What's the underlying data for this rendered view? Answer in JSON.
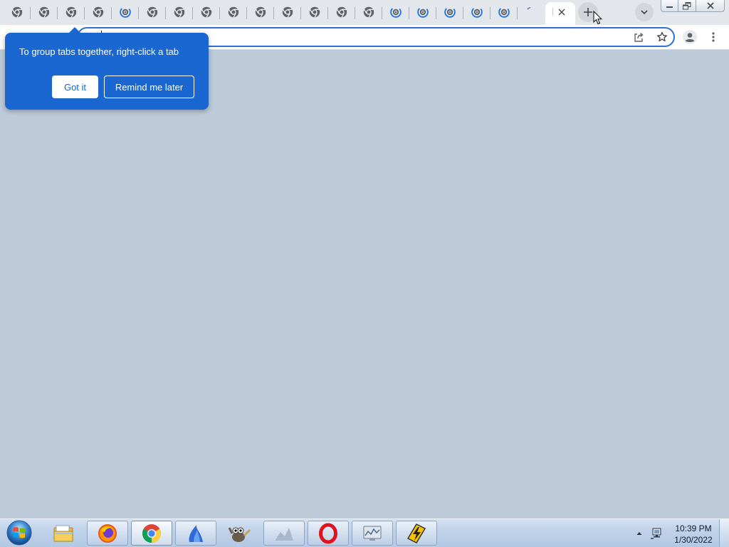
{
  "browser": {
    "tabs": [
      {
        "favicon": "chrome-icon"
      },
      {
        "favicon": "chrome-icon"
      },
      {
        "favicon": "chrome-icon"
      },
      {
        "favicon": "chrome-icon"
      },
      {
        "favicon": "loading-chrome-icon"
      },
      {
        "favicon": "chrome-icon"
      },
      {
        "favicon": "chrome-icon"
      },
      {
        "favicon": "chrome-icon"
      },
      {
        "favicon": "chrome-icon"
      },
      {
        "favicon": "chrome-icon"
      },
      {
        "favicon": "chrome-icon"
      },
      {
        "favicon": "chrome-icon"
      },
      {
        "favicon": "chrome-icon"
      },
      {
        "favicon": "chrome-icon"
      },
      {
        "favicon": "loading-chrome-icon"
      },
      {
        "favicon": "loading-chrome-icon"
      },
      {
        "favicon": "loading-chrome-icon"
      },
      {
        "favicon": "loading-chrome-icon"
      },
      {
        "favicon": "loading-chrome-icon"
      },
      {
        "favicon": "loading-spinner-icon"
      }
    ],
    "active_tab": {
      "favicon": "blank-favicon-icon"
    },
    "icons": {
      "close_tab": "close-icon",
      "new_tab": "plus-icon",
      "tab_search": "chevron-down-icon",
      "minimize": "minimize-icon",
      "restore": "restore-icon",
      "close_window": "window-close-icon",
      "share": "share-icon",
      "bookmark": "star-icon",
      "profile": "profile-avatar-icon",
      "menu": "more-vert-icon",
      "pointer": "mouse-cursor-icon"
    },
    "omnibox": {
      "value": ""
    }
  },
  "feature_promo": {
    "message": "To group tabs together, right-click a tab",
    "primary_button": "Got it",
    "secondary_button": "Remind me later"
  },
  "taskbar": {
    "start_icon": "windows-start-orb-icon",
    "apps": [
      {
        "icon": "file-explorer-icon",
        "running": false,
        "active": false
      },
      {
        "icon": "firefox-icon",
        "running": true,
        "active": false
      },
      {
        "icon": "chrome-icon",
        "running": true,
        "active": true
      },
      {
        "icon": "blue-flame-app-icon",
        "running": true,
        "active": false
      },
      {
        "icon": "gimp-icon",
        "running": false,
        "active": false
      },
      {
        "icon": "faded-app-icon",
        "running": true,
        "active": false
      },
      {
        "icon": "opera-icon",
        "running": true,
        "active": false
      },
      {
        "icon": "system-monitor-icon",
        "running": true,
        "active": false
      },
      {
        "icon": "winamp-icon",
        "running": true,
        "active": false
      }
    ],
    "tray": {
      "icons": [
        "show-hidden-icons-icon",
        "network-icon"
      ],
      "time": "10:39 PM",
      "date": "1/30/2022"
    }
  },
  "colors": {
    "content_background": "#bccad9",
    "promo_background": "#1a67d2",
    "tab_strip": "#e3e6ea",
    "loading_blue": "#1a73e8"
  }
}
